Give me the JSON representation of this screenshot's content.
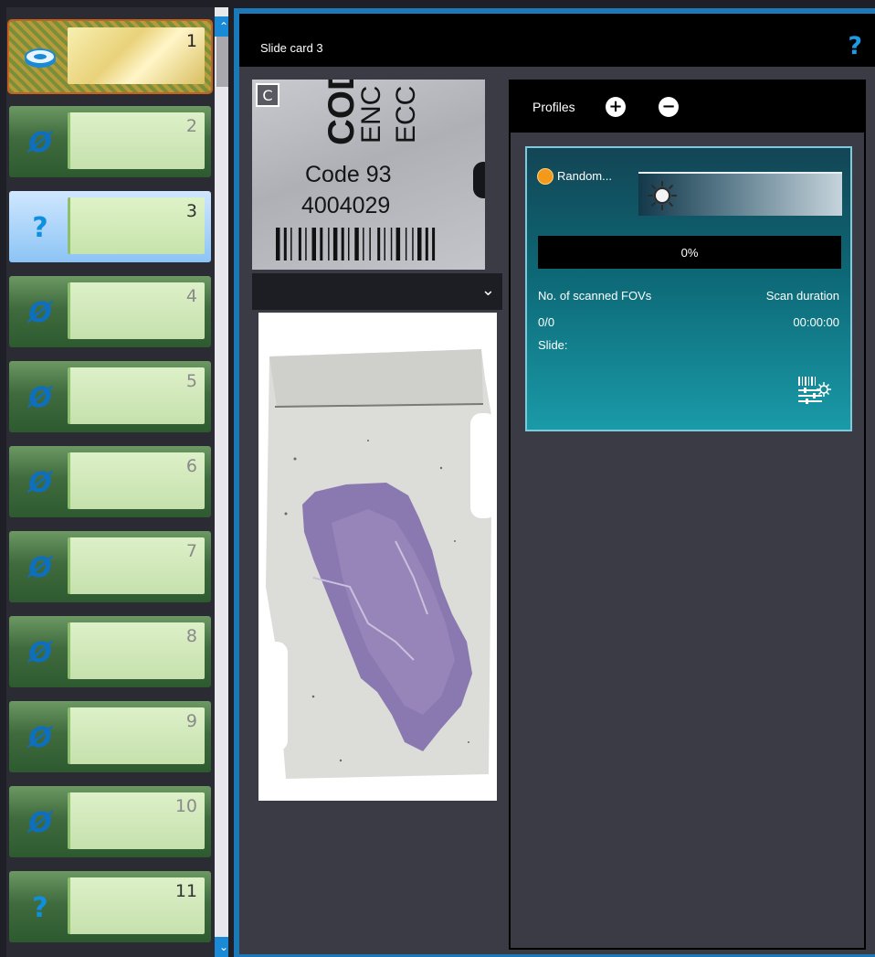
{
  "rack": {
    "slots": [
      {
        "number": "1",
        "state": "loaded",
        "icon": "slide-tray-icon"
      },
      {
        "number": "2",
        "state": "empty",
        "icon": "empty-slot-icon"
      },
      {
        "number": "3",
        "state": "unknown",
        "icon": "question-icon"
      },
      {
        "number": "4",
        "state": "empty",
        "icon": "empty-slot-icon"
      },
      {
        "number": "5",
        "state": "empty",
        "icon": "empty-slot-icon"
      },
      {
        "number": "6",
        "state": "empty",
        "icon": "empty-slot-icon"
      },
      {
        "number": "7",
        "state": "empty",
        "icon": "empty-slot-icon"
      },
      {
        "number": "8",
        "state": "empty",
        "icon": "empty-slot-icon"
      },
      {
        "number": "9",
        "state": "empty",
        "icon": "empty-slot-icon"
      },
      {
        "number": "10",
        "state": "empty",
        "icon": "empty-slot-icon"
      },
      {
        "number": "11",
        "state": "unknown",
        "icon": "question-icon"
      }
    ],
    "empty_glyph": "Ø",
    "question_glyph": "?",
    "scroll_up_glyph": "⌃",
    "scroll_down_glyph": "⌄"
  },
  "card": {
    "title": "Slide card 3",
    "help_glyph": "?",
    "label_image": {
      "line1": "COD",
      "line2": "ENC",
      "line3": "ECC",
      "code_text": "Code 93",
      "number_text": "4004029"
    },
    "rotate_glyph": "C",
    "dropdown_value": "",
    "dropdown_glyph": "⌄"
  },
  "profiles": {
    "title": "Profiles",
    "add_glyph": "+",
    "remove_glyph": "−",
    "items": [
      {
        "name": "Random...",
        "status_color": "#f39a1c",
        "progress": 0,
        "progress_text": "0%",
        "fovs_label": "No. of scanned FOVs",
        "fovs_value": "0/0",
        "duration_label": "Scan duration",
        "duration_value": "00:00:00",
        "slide_label": "Slide:"
      }
    ]
  },
  "colors": {
    "accent": "#1b79b8",
    "help": "#1d9be8",
    "progress": "#1b9be3",
    "status_orange": "#f39a1c"
  }
}
